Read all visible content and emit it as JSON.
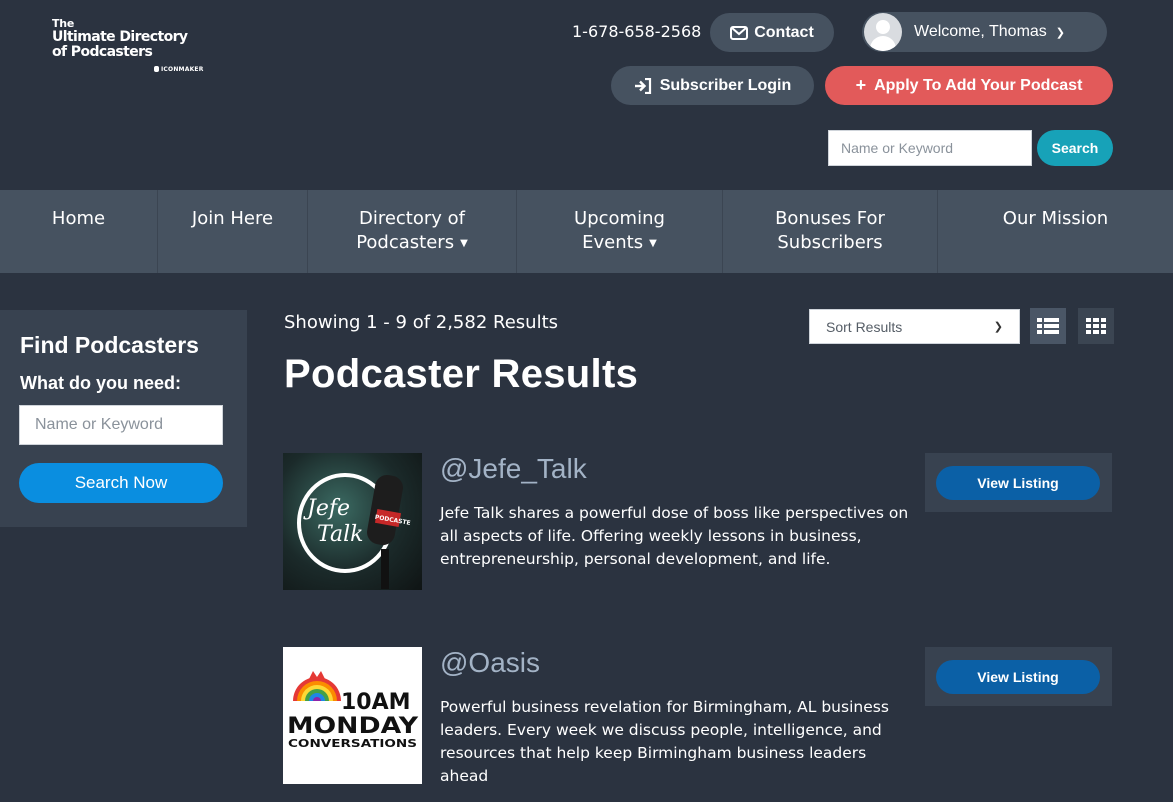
{
  "logo": {
    "line_the": "The",
    "line1": "Ultimate Directory",
    "line2": "of Podcasters",
    "maker": "ICONMAKER"
  },
  "header": {
    "phone": "1-678-658-2568",
    "contact_label": "Contact",
    "welcome_label": "Welcome, Thomas",
    "subscriber_login_label": "Subscriber Login",
    "apply_label": "Apply To Add Your Podcast",
    "search_placeholder": "Name or Keyword",
    "search_button": "Search"
  },
  "nav": {
    "items": [
      {
        "label": "Home",
        "width": 158,
        "dropdown": false
      },
      {
        "label": "Join Here",
        "width": 150,
        "dropdown": false
      },
      {
        "label": "Directory of Podcasters",
        "width": 209,
        "dropdown": true
      },
      {
        "label": "Upcoming Events",
        "width": 206,
        "dropdown": true
      },
      {
        "label": "Bonuses For Subscribers",
        "width": 215,
        "dropdown": false
      },
      {
        "label": "Our Mission",
        "width": 235,
        "dropdown": false
      }
    ]
  },
  "sidebar": {
    "title": "Find Podcasters",
    "subtitle": "What do you need:",
    "placeholder": "Name or Keyword",
    "button": "Search Now"
  },
  "main": {
    "showing": "Showing 1 - 9 of 2,582 Results",
    "title": "Podcaster Results",
    "sort_label": "Sort Results",
    "results": [
      {
        "handle": "@Jefe_Talk",
        "description": "Jefe Talk shares a powerful dose of boss like perspectives on all aspects of life. Offering weekly lessons in business, entrepreneurship, personal development, and life.",
        "thumb_text_a": "Jefe",
        "thumb_text_b": "Talk",
        "thumb_mic_text": "PODCASTE",
        "button": "View Listing"
      },
      {
        "handle": "@Oasis",
        "description": "Powerful business revelation for Birmingham, AL business leaders. Every week we discuss people, intelligence, and resources that help keep Birmingham business leaders ahead",
        "thumb_line1": "10AM",
        "thumb_line2": "MONDAY",
        "thumb_line3": "CONVERSATIONS",
        "button": "View Listing"
      }
    ]
  },
  "colors": {
    "background": "#2b3340",
    "nav": "#465260",
    "accent_red": "#e25a5a",
    "accent_teal": "#17a2b8",
    "accent_blue": "#0a8ee0",
    "listing_blue": "#0b60a6",
    "handle": "#a3b3c6"
  }
}
